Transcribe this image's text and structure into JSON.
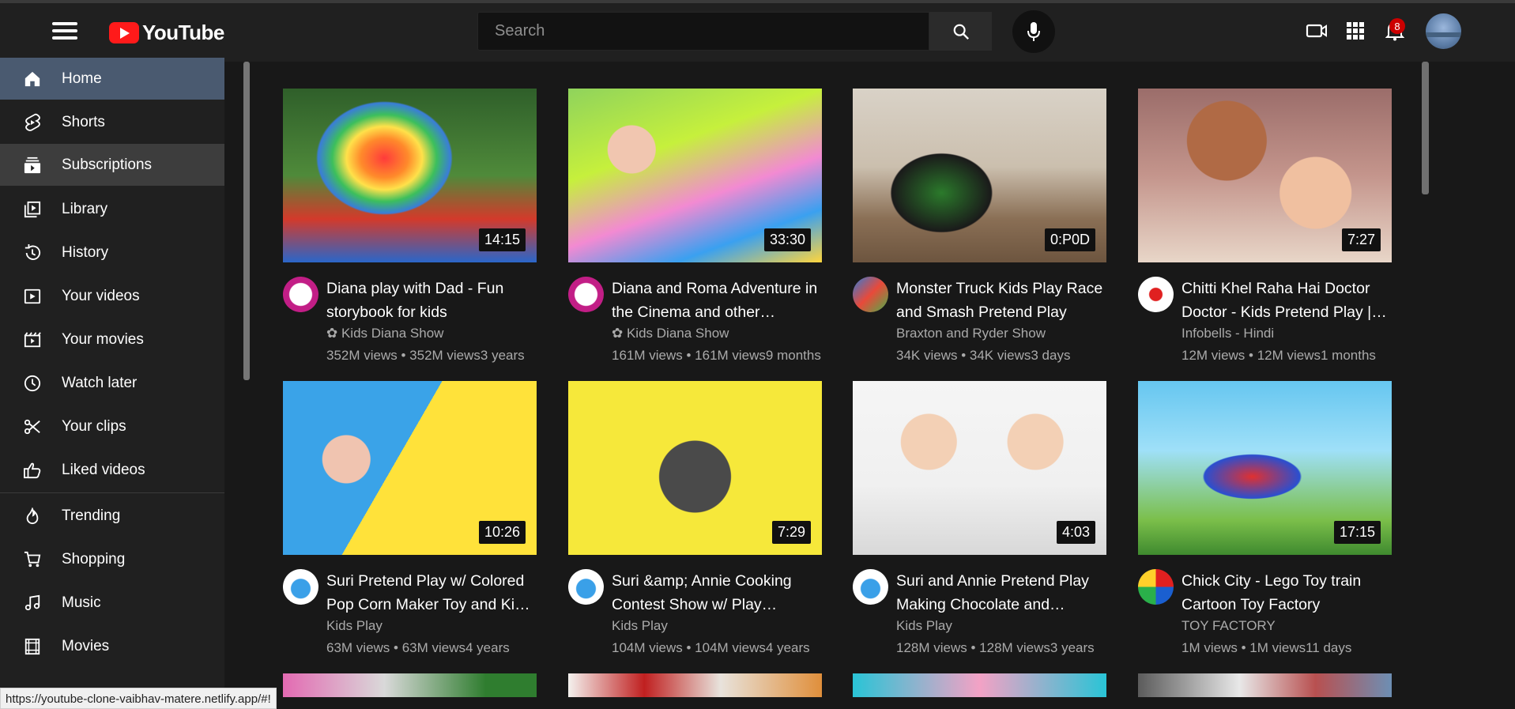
{
  "header": {
    "logo_text": "YouTube",
    "search_placeholder": "Search",
    "notification_count": "8",
    "brand_color": "#ff1a1a"
  },
  "sidebar": {
    "items": [
      {
        "label": "Home",
        "icon": "home-icon"
      },
      {
        "label": "Shorts",
        "icon": "shorts-icon"
      },
      {
        "label": "Subscriptions",
        "icon": "subscriptions-icon"
      },
      {
        "label": "Library",
        "icon": "library-icon"
      },
      {
        "label": "History",
        "icon": "history-icon"
      },
      {
        "label": "Your videos",
        "icon": "your-videos-icon"
      },
      {
        "label": "Your movies",
        "icon": "your-movies-icon"
      },
      {
        "label": "Watch later",
        "icon": "watch-later-icon"
      },
      {
        "label": "Your clips",
        "icon": "scissors-icon"
      },
      {
        "label": "Liked videos",
        "icon": "thumbs-up-icon"
      },
      {
        "label": "Trending",
        "icon": "flame-icon"
      },
      {
        "label": "Shopping",
        "icon": "shopping-cart-icon"
      },
      {
        "label": "Music",
        "icon": "music-note-icon"
      },
      {
        "label": "Movies",
        "icon": "film-icon"
      }
    ]
  },
  "videos": [
    {
      "title1": "Diana play with Dad - Fun",
      "title2": "storybook for kids",
      "channel": "✿ Kids Diana Show",
      "meta": "352M views • 352M views3 years",
      "duration": "14:15"
    },
    {
      "title1": "Diana and Roma Adventure in",
      "title2": "the Cinema and other…",
      "channel": "✿ Kids Diana Show",
      "meta": "161M views • 161M views9 months",
      "duration": "33:30"
    },
    {
      "title1": "Monster Truck Kids Play Race",
      "title2": "and Smash Pretend Play",
      "channel": "Braxton and Ryder Show",
      "meta": "34K views • 34K views3 days",
      "duration": "0:P0D"
    },
    {
      "title1": "Chitti Khel Raha Hai Doctor",
      "title2": "Doctor - Kids Pretend Play |…",
      "channel": "Infobells - Hindi",
      "meta": "12M views • 12M views1 months",
      "duration": "7:27"
    },
    {
      "title1": "Suri Pretend Play w/ Colored",
      "title2": "Pop Corn Maker Toy and Kid…",
      "channel": "Kids Play",
      "meta": "63M views • 63M views4 years",
      "duration": "10:26"
    },
    {
      "title1": "Suri &amp; Annie Cooking",
      "title2": "Contest Show w/ Play…",
      "channel": "Kids Play",
      "meta": "104M views • 104M views4 years",
      "duration": "7:29"
    },
    {
      "title1": "Suri and Annie Pretend Play",
      "title2": "Making Chocolate and…",
      "channel": "Kids Play",
      "meta": "128M views • 128M views3 years",
      "duration": "4:03"
    },
    {
      "title1": "Chick City - Lego Toy train",
      "title2": "Cartoon Toy Factory",
      "channel": "TOY FACTORY",
      "meta": "1M views • 1M views11 days",
      "duration": "17:15"
    }
  ],
  "status_url": "https://youtube-clone-vaibhav-matere.netlify.app/#!"
}
